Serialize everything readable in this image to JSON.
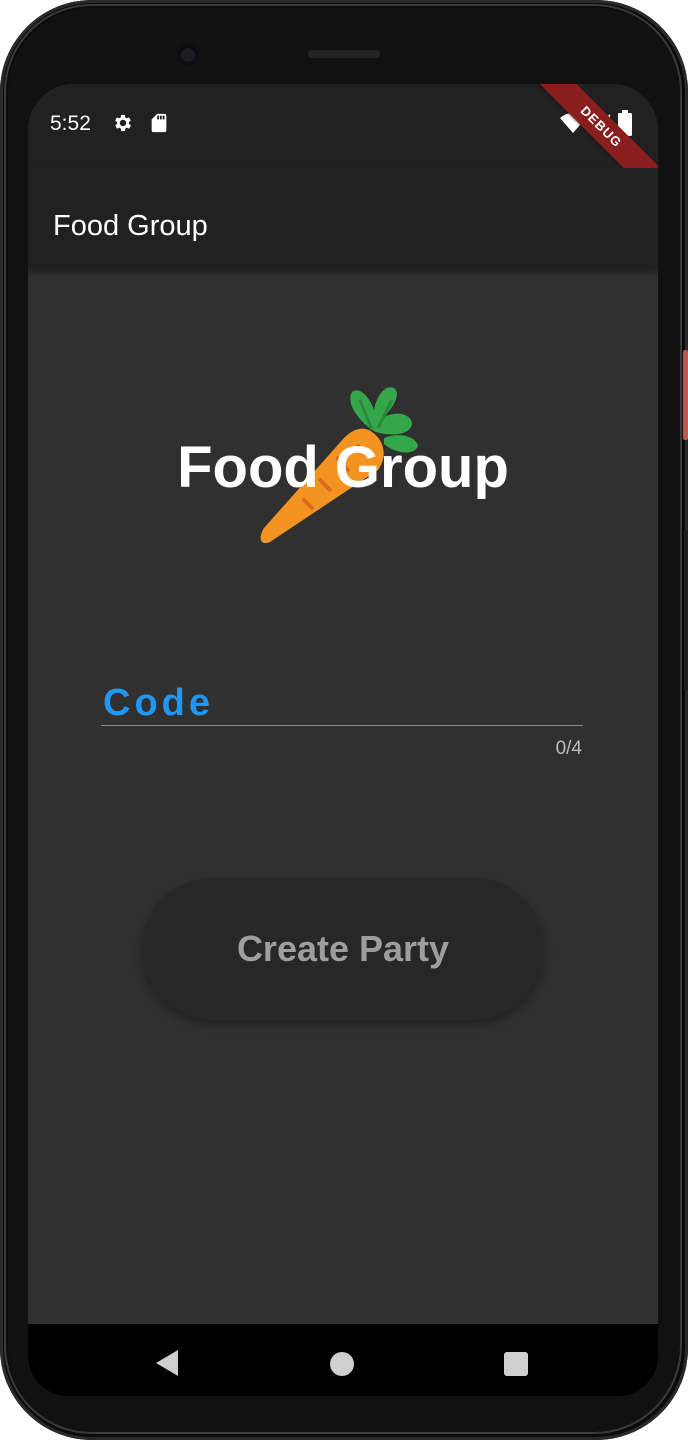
{
  "status_bar": {
    "time": "5:52"
  },
  "app_bar": {
    "title": "Food Group"
  },
  "debug_banner": {
    "text": "DEBUG"
  },
  "logo": {
    "text": "Food Group"
  },
  "code_field": {
    "label": "Code",
    "value": "",
    "counter": "0/4"
  },
  "create_button": {
    "label": "Create Party"
  },
  "colors": {
    "accent": "#2196f3",
    "background": "#303030",
    "app_bar": "#212121",
    "button": "#272727",
    "debug_banner": "#8a1e1e",
    "carrot": "#f39422",
    "leaves": "#35a64a"
  },
  "icons": [
    "gear-icon",
    "sd-card-icon",
    "wifi-icon",
    "cellular-signal-icon",
    "battery-icon",
    "back-icon",
    "home-icon",
    "recents-icon"
  ]
}
